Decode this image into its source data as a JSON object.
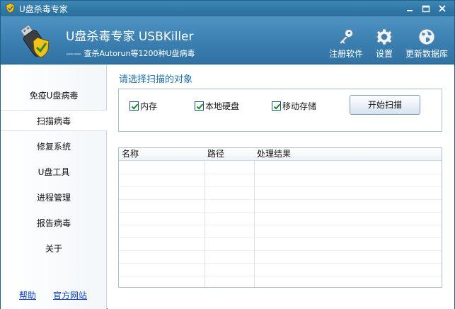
{
  "window": {
    "title": "U盘杀毒专家"
  },
  "header": {
    "app_name": "U盘杀毒专家  USBKiller",
    "app_subtitle": "—— 查杀Autorun等1200种U盘病毒",
    "buttons": [
      {
        "label": "注册软件",
        "icon": "key-icon"
      },
      {
        "label": "设置",
        "icon": "gear-icon"
      },
      {
        "label": "更新数据库",
        "icon": "globe-icon"
      }
    ]
  },
  "sidebar": {
    "items": [
      {
        "label": "免疫U盘病毒"
      },
      {
        "label": "扫描病毒"
      },
      {
        "label": "修复系统"
      },
      {
        "label": "U盘工具"
      },
      {
        "label": "进程管理"
      },
      {
        "label": "报告病毒"
      },
      {
        "label": "关于"
      }
    ],
    "active_index": 1,
    "links": {
      "help": "帮助",
      "website": "官方网站"
    }
  },
  "main": {
    "section_title": "请选择扫描的对象",
    "options": [
      {
        "label": "内存",
        "checked": true
      },
      {
        "label": "本地硬盘",
        "checked": true
      },
      {
        "label": "移动存储",
        "checked": true
      }
    ],
    "scan_button": "开始扫描",
    "table": {
      "columns": [
        "名称",
        "路径",
        "处理结果"
      ],
      "rows": []
    }
  },
  "colors": {
    "title_bar": "#2f76a6",
    "header": "#3b7fb0",
    "accent_text": "#1f6ea8",
    "link": "#0a3ec4"
  }
}
